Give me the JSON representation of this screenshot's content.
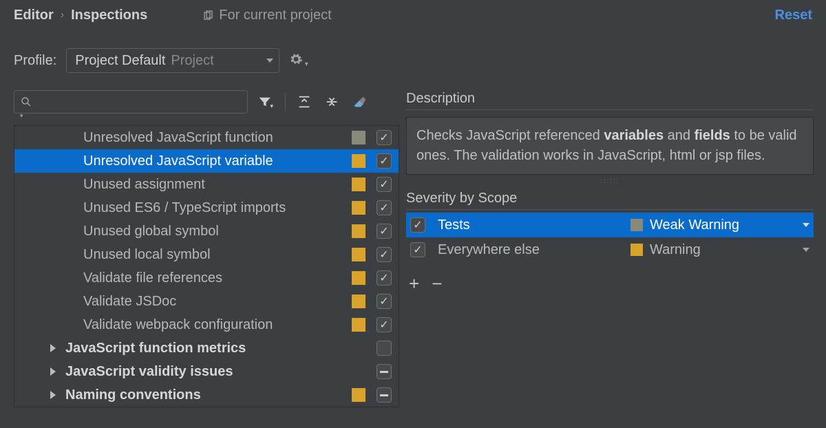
{
  "header": {
    "breadcrumb": [
      "Editor",
      "Inspections"
    ],
    "for_current_project": "For current project",
    "reset": "Reset"
  },
  "profile": {
    "label": "Profile:",
    "value": "Project Default",
    "scope": "Project"
  },
  "search": {
    "placeholder": ""
  },
  "inspections": [
    {
      "name": "Unresolved JavaScript function",
      "severity": "weak",
      "checked": true,
      "selected": false,
      "group": false
    },
    {
      "name": "Unresolved JavaScript variable",
      "severity": "warn",
      "checked": true,
      "selected": true,
      "group": false
    },
    {
      "name": "Unused assignment",
      "severity": "warn",
      "checked": true,
      "selected": false,
      "group": false
    },
    {
      "name": "Unused ES6 / TypeScript imports",
      "severity": "warn",
      "checked": true,
      "selected": false,
      "group": false
    },
    {
      "name": "Unused global symbol",
      "severity": "warn",
      "checked": true,
      "selected": false,
      "group": false
    },
    {
      "name": "Unused local symbol",
      "severity": "warn",
      "checked": true,
      "selected": false,
      "group": false
    },
    {
      "name": "Validate file references",
      "severity": "warn",
      "checked": true,
      "selected": false,
      "group": false
    },
    {
      "name": "Validate JSDoc",
      "severity": "warn",
      "checked": true,
      "selected": false,
      "group": false
    },
    {
      "name": "Validate webpack configuration",
      "severity": "warn",
      "checked": true,
      "selected": false,
      "group": false
    },
    {
      "name": "JavaScript function metrics",
      "severity": "",
      "checked": "none",
      "selected": false,
      "group": true
    },
    {
      "name": "JavaScript validity issues",
      "severity": "",
      "checked": "mixed",
      "selected": false,
      "group": true
    },
    {
      "name": "Naming conventions",
      "severity": "warn",
      "checked": "mixed",
      "selected": false,
      "group": true
    }
  ],
  "description": {
    "title": "Description",
    "text_pre": "Checks JavaScript referenced ",
    "bold1": "variables",
    "mid": " and ",
    "bold2": "fields",
    "text_post": " to be valid ones. The validation works in JavaScript, html or jsp files."
  },
  "severity": {
    "title": "Severity by Scope",
    "rows": [
      {
        "checked": true,
        "scope": "Tests",
        "sev_color": "weak",
        "sev_label": "Weak Warning",
        "selected": true
      },
      {
        "checked": true,
        "scope": "Everywhere else",
        "sev_color": "warn",
        "sev_label": "Warning",
        "selected": false
      }
    ]
  },
  "colors": {
    "warn": "#d9a22a",
    "weak": "#8a8a7a",
    "select": "#0a6bcb"
  }
}
